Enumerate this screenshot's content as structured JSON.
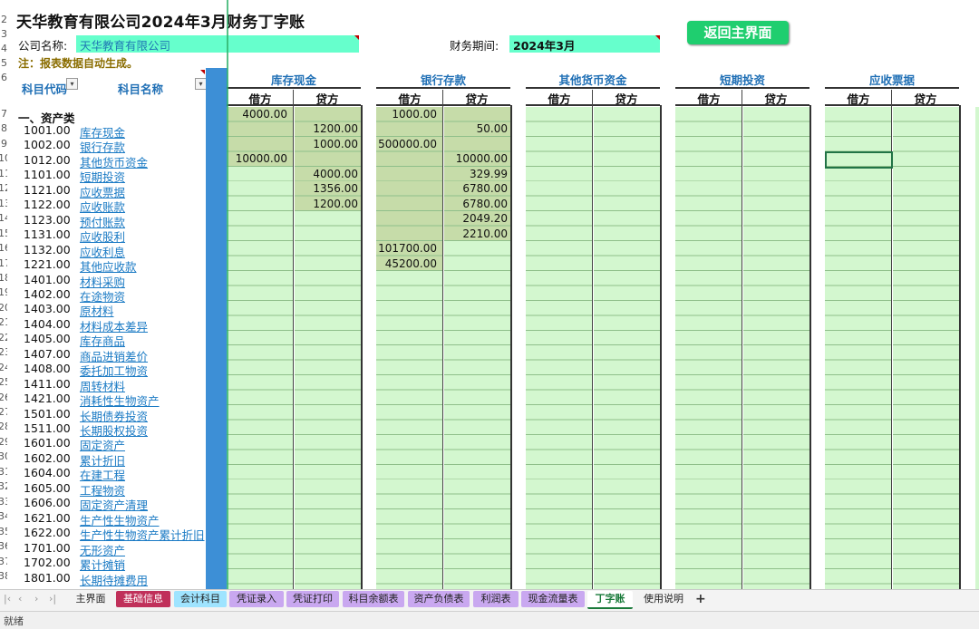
{
  "title": "天华教育有限公司2024年3月财务丁字账",
  "company": {
    "label": "公司名称:",
    "value": "天华教育有限公司"
  },
  "period": {
    "label": "财务期间:",
    "value": "2024年3月"
  },
  "note": "注：报表数据自动生成。",
  "return_button": "返回主界面",
  "headers": {
    "code": "科目代码",
    "name": "科目名称"
  },
  "category": "一、资产类",
  "row_numbers": [
    "2",
    "3",
    "4",
    "5",
    "6",
    "7",
    "8",
    "9",
    "10",
    "11",
    "12",
    "13",
    "14",
    "15",
    "16",
    "17",
    "18",
    "19",
    "20",
    "21",
    "22",
    "23",
    "24",
    "25",
    "26",
    "27",
    "28",
    "29",
    "30",
    "31",
    "32",
    "33",
    "34",
    "35",
    "36",
    "37",
    "38"
  ],
  "accounts": [
    {
      "code": "1001.00",
      "name": "库存现金"
    },
    {
      "code": "1002.00",
      "name": "银行存款"
    },
    {
      "code": "1012.00",
      "name": "其他货币资金"
    },
    {
      "code": "1101.00",
      "name": "短期投资"
    },
    {
      "code": "1121.00",
      "name": "应收票据"
    },
    {
      "code": "1122.00",
      "name": "应收账款"
    },
    {
      "code": "1123.00",
      "name": "预付账款"
    },
    {
      "code": "1131.00",
      "name": "应收股利"
    },
    {
      "code": "1132.00",
      "name": "应收利息"
    },
    {
      "code": "1221.00",
      "name": "其他应收款"
    },
    {
      "code": "1401.00",
      "name": "材料采购"
    },
    {
      "code": "1402.00",
      "name": "在途物资"
    },
    {
      "code": "1403.00",
      "name": "原材料"
    },
    {
      "code": "1404.00",
      "name": "材料成本差异"
    },
    {
      "code": "1405.00",
      "name": "库存商品"
    },
    {
      "code": "1407.00",
      "name": "商品进销差价"
    },
    {
      "code": "1408.00",
      "name": "委托加工物资"
    },
    {
      "code": "1411.00",
      "name": "周转材料"
    },
    {
      "code": "1421.00",
      "name": "消耗性生物资产"
    },
    {
      "code": "1501.00",
      "name": "长期债券投资"
    },
    {
      "code": "1511.00",
      "name": "长期股权投资"
    },
    {
      "code": "1601.00",
      "name": "固定资产"
    },
    {
      "code": "1602.00",
      "name": "累计折旧"
    },
    {
      "code": "1604.00",
      "name": "在建工程"
    },
    {
      "code": "1605.00",
      "name": "工程物资"
    },
    {
      "code": "1606.00",
      "name": "固定资产清理"
    },
    {
      "code": "1621.00",
      "name": "生产性生物资产"
    },
    {
      "code": "1622.00",
      "name": "生产性生物资产累计折旧"
    },
    {
      "code": "1701.00",
      "name": "无形资产"
    },
    {
      "code": "1702.00",
      "name": "累计摊销"
    },
    {
      "code": "1801.00",
      "name": "长期待摊费用"
    }
  ],
  "sections": [
    {
      "title": "库存现金",
      "debit_label": "借方",
      "credit_label": "贷方",
      "debit": [
        "4000.00",
        "",
        "",
        "10000.00"
      ],
      "credit": [
        "",
        "1200.00",
        "1000.00",
        "",
        "4000.00",
        "1356.00",
        "1200.00"
      ]
    },
    {
      "title": "银行存款",
      "debit_label": "借方",
      "credit_label": "贷方",
      "debit": [
        "1000.00",
        "",
        "500000.00",
        "",
        "",
        "",
        "",
        "",
        "",
        "101700.00",
        "45200.00"
      ],
      "credit": [
        "",
        "50.00",
        "",
        "10000.00",
        "329.99",
        "6780.00",
        "6780.00",
        "2049.20",
        "2210.00"
      ]
    },
    {
      "title": "其他货币资金",
      "debit_label": "借方",
      "credit_label": "贷方",
      "debit": [],
      "credit": []
    },
    {
      "title": "短期投资",
      "debit_label": "借方",
      "credit_label": "贷方",
      "debit": [],
      "credit": []
    },
    {
      "title": "应收票据",
      "debit_label": "借方",
      "credit_label": "贷方",
      "debit": [],
      "credit": []
    }
  ],
  "tabs": [
    {
      "label": "主界面",
      "bg": "#f3f3f3",
      "color": "#222"
    },
    {
      "label": "基础信息",
      "bg": "#c0305a",
      "color": "#ffffff"
    },
    {
      "label": "会计科目",
      "bg": "#9fe4ff",
      "color": "#222"
    },
    {
      "label": "凭证录入",
      "bg": "#c9a8f0",
      "color": "#222"
    },
    {
      "label": "凭证打印",
      "bg": "#c9a8f0",
      "color": "#222"
    },
    {
      "label": "科目余额表",
      "bg": "#c9a8f0",
      "color": "#222"
    },
    {
      "label": "资产负债表",
      "bg": "#c9a8f0",
      "color": "#222"
    },
    {
      "label": "利润表",
      "bg": "#c9a8f0",
      "color": "#222"
    },
    {
      "label": "现金流量表",
      "bg": "#c9a8f0",
      "color": "#222"
    },
    {
      "label": "丁字账",
      "bg": "#ffffff",
      "color": "#1a7a3a"
    },
    {
      "label": "使用说明",
      "bg": "#f3f3f3",
      "color": "#222"
    }
  ],
  "add_sheet": "+",
  "status_text": "就绪",
  "colors": {
    "grid_green": "#d3f7cf",
    "shade": "#c6dca9",
    "header_blue": "#1f6fb5",
    "button_green": "#1fce6f",
    "input_teal": "#66ffcc"
  }
}
